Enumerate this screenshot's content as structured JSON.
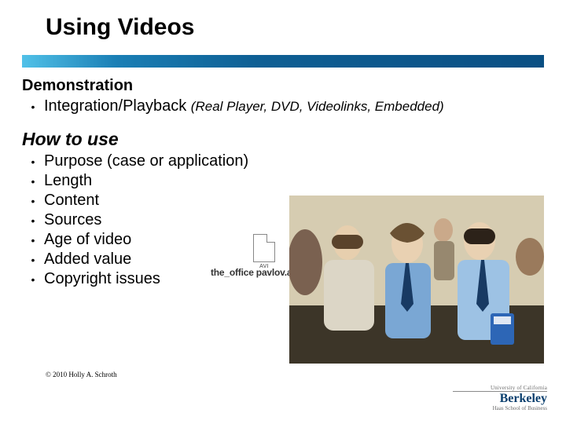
{
  "title": "Using Videos",
  "section1": {
    "heading": "Demonstration",
    "bullets": [
      {
        "text": "Integration/Playback",
        "note": "(Real Player, DVD, Videolinks, Embedded)"
      }
    ]
  },
  "section2": {
    "heading": "How to use",
    "bullets": [
      "Purpose (case or application)",
      "Length",
      "Content",
      "Sources",
      "Age of video",
      "Added value",
      "Copyright issues"
    ]
  },
  "file_icon": {
    "badge": "AVI",
    "caption": "the_office pavlov.av"
  },
  "copyright": "© 2010 Holly A. Schroth",
  "logo": {
    "top": "University of California",
    "main": "Berkeley",
    "sub": "Haas School of Business"
  }
}
